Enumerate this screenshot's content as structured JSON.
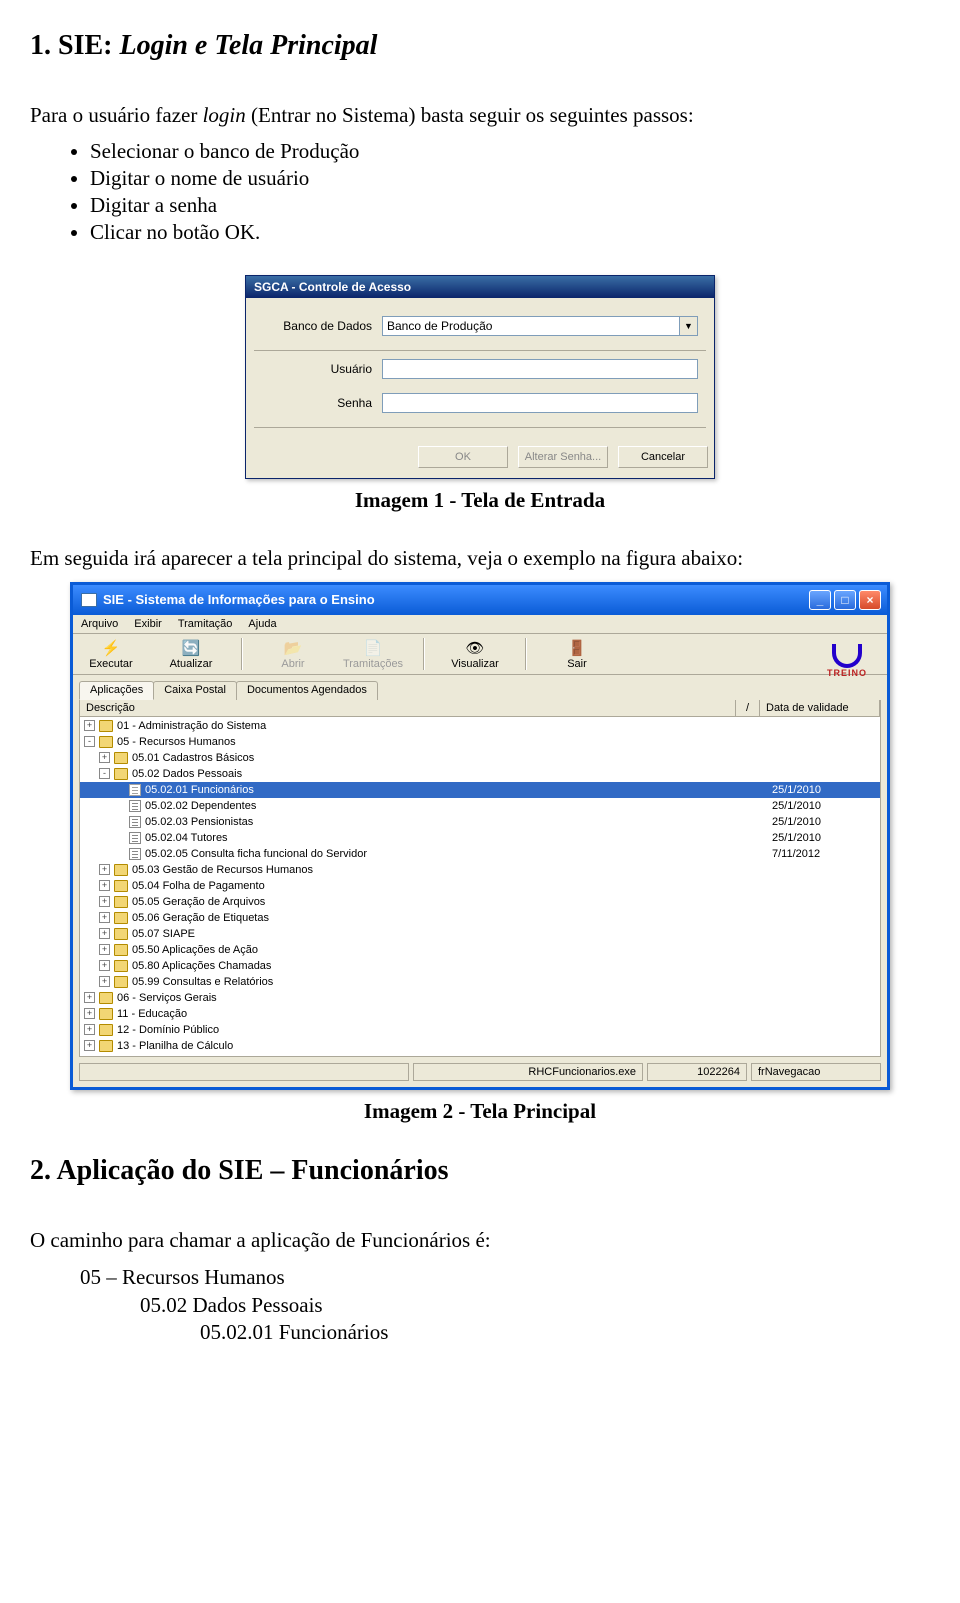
{
  "heading1": {
    "num": "1. SIE: ",
    "italic": "Login e Tela Principal"
  },
  "para1_a": "Para o usuário fazer ",
  "para1_login": "login",
  "para1_b": " (Entrar no Sistema) basta seguir os seguintes passos:",
  "bullets1": [
    "Selecionar o banco de Produção",
    "Digitar o nome de usuário",
    "Digitar a senha",
    "Clicar no botão OK."
  ],
  "login": {
    "title": "SGCA - Controle de Acesso",
    "lbl_db": "Banco de Dados",
    "val_db": "Banco de Produção",
    "lbl_user": "Usuário",
    "lbl_pass": "Senha",
    "btn_ok": "OK",
    "btn_alter": "Alterar Senha...",
    "btn_cancel": "Cancelar"
  },
  "caption1": "Imagem 1 - Tela de Entrada",
  "para2": "Em seguida irá aparecer a tela principal do sistema, veja o exemplo na figura abaixo:",
  "sie": {
    "title": "SIE - Sistema de Informações para o Ensino",
    "menu": {
      "arquivo": "Arquivo",
      "exibir": "Exibir",
      "tramit": "Tramitação",
      "ajuda": "Ajuda"
    },
    "tool": {
      "exec": "Executar",
      "atual": "Atualizar",
      "abrir": "Abrir",
      "tram": "Tramitações",
      "vis": "Visualizar",
      "sair": "Sair"
    },
    "logo": "TREINO",
    "tabs": {
      "app": "Aplicações",
      "caixa": "Caixa Postal",
      "docs": "Documentos Agendados"
    },
    "col_desc": "Descrição",
    "col_sort": "/",
    "col_date": "Data de validade",
    "rows": [
      {
        "lvl": 0,
        "exp": "+",
        "type": "f",
        "txt": "01 - Administração do Sistema",
        "dt": ""
      },
      {
        "lvl": 0,
        "exp": "-",
        "type": "f",
        "txt": "05 - Recursos Humanos",
        "dt": ""
      },
      {
        "lvl": 1,
        "exp": "+",
        "type": "f",
        "txt": "05.01 Cadastros Básicos",
        "dt": ""
      },
      {
        "lvl": 1,
        "exp": "-",
        "type": "f",
        "txt": "05.02 Dados Pessoais",
        "dt": ""
      },
      {
        "lvl": 2,
        "exp": "",
        "type": "d",
        "txt": "05.02.01 Funcionários",
        "dt": "25/1/2010",
        "sel": true
      },
      {
        "lvl": 2,
        "exp": "",
        "type": "d",
        "txt": "05.02.02 Dependentes",
        "dt": "25/1/2010"
      },
      {
        "lvl": 2,
        "exp": "",
        "type": "d",
        "txt": "05.02.03 Pensionistas",
        "dt": "25/1/2010"
      },
      {
        "lvl": 2,
        "exp": "",
        "type": "d",
        "txt": "05.02.04 Tutores",
        "dt": "25/1/2010"
      },
      {
        "lvl": 2,
        "exp": "",
        "type": "d",
        "txt": "05.02.05 Consulta ficha funcional do Servidor",
        "dt": "7/11/2012"
      },
      {
        "lvl": 1,
        "exp": "+",
        "type": "f",
        "txt": "05.03 Gestão de Recursos Humanos",
        "dt": ""
      },
      {
        "lvl": 1,
        "exp": "+",
        "type": "f",
        "txt": "05.04 Folha de Pagamento",
        "dt": ""
      },
      {
        "lvl": 1,
        "exp": "+",
        "type": "f",
        "txt": "05.05 Geração de Arquivos",
        "dt": ""
      },
      {
        "lvl": 1,
        "exp": "+",
        "type": "f",
        "txt": "05.06 Geração de Etiquetas",
        "dt": ""
      },
      {
        "lvl": 1,
        "exp": "+",
        "type": "f",
        "txt": "05.07 SIAPE",
        "dt": ""
      },
      {
        "lvl": 1,
        "exp": "+",
        "type": "f",
        "txt": "05.50 Aplicações de Ação",
        "dt": ""
      },
      {
        "lvl": 1,
        "exp": "+",
        "type": "f",
        "txt": "05.80 Aplicações Chamadas",
        "dt": ""
      },
      {
        "lvl": 1,
        "exp": "+",
        "type": "f",
        "txt": "05.99 Consultas e Relatórios",
        "dt": ""
      },
      {
        "lvl": 0,
        "exp": "+",
        "type": "f",
        "txt": "06 - Serviços Gerais",
        "dt": ""
      },
      {
        "lvl": 0,
        "exp": "+",
        "type": "f",
        "txt": "11 - Educação",
        "dt": ""
      },
      {
        "lvl": 0,
        "exp": "+",
        "type": "f",
        "txt": "12 - Domínio Público",
        "dt": ""
      },
      {
        "lvl": 0,
        "exp": "+",
        "type": "f",
        "txt": "13 - Planilha de Cálculo",
        "dt": ""
      }
    ],
    "status": {
      "exe": "RHCFuncionarios.exe",
      "num": "1022264",
      "frm": "frNavegacao"
    }
  },
  "caption2": "Imagem 2 - Tela Principal",
  "heading2": "2. Aplicação do SIE – Funcionários",
  "para3": "O caminho para chamar a aplicação de Funcionários é:",
  "path1": "05 – Recursos Humanos",
  "path2": "05.02 Dados Pessoais",
  "path3": "05.02.01 Funcionários"
}
